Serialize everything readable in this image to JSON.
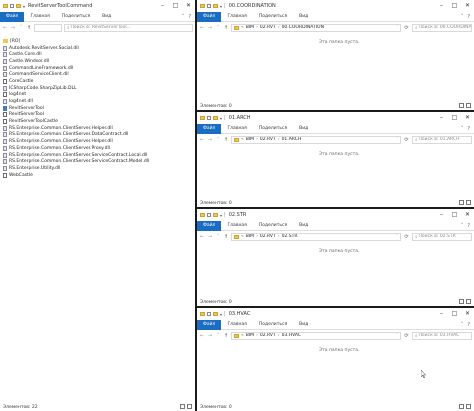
{
  "ribbon": {
    "file": "Файл",
    "home": "Главная",
    "share": "Поделиться",
    "view": "Вид"
  },
  "left": {
    "title": "RevitServerToolCommand",
    "search_placeholder": "Поиск в: RevitServerTool...",
    "files": [
      {
        "name": "[RO]",
        "type": "folder"
      },
      {
        "name": "Autodesk.RevitServer.Social.dll",
        "type": "dll"
      },
      {
        "name": "Castle.Core.dll",
        "type": "dll"
      },
      {
        "name": "Castle.Windsor.dll",
        "type": "dll"
      },
      {
        "name": "CommandLineFramework.dll",
        "type": "dll"
      },
      {
        "name": "CommandServiceClient.dll",
        "type": "dll"
      },
      {
        "name": "CoreCastle",
        "type": "config"
      },
      {
        "name": "ICSharpCode.SharpZipLib.DLL",
        "type": "dll"
      },
      {
        "name": "log4net",
        "type": "config"
      },
      {
        "name": "log4net.dll",
        "type": "dll"
      },
      {
        "name": "RevitServerTool",
        "type": "exe"
      },
      {
        "name": "RevitServerTool",
        "type": "config"
      },
      {
        "name": "RevitServerToolCastle",
        "type": "config"
      },
      {
        "name": "RS.Enterprise.Common.ClientServer.Helper.dll",
        "type": "dll"
      },
      {
        "name": "RS.Enterprise.Common.ClientServer.DataContract.dll",
        "type": "dll"
      },
      {
        "name": "RS.Enterprise.Common.ClientServer.Helper.dll",
        "type": "dll"
      },
      {
        "name": "RS.Enterprise.Common.ClientServer.Proxy.dll",
        "type": "dll"
      },
      {
        "name": "RS.Enterprise.Common.ClientServer.ServiceContract.Local.dll",
        "type": "dll"
      },
      {
        "name": "RS.Enterprise.Common.ClientServer.ServiceContract.Model.dll",
        "type": "dll"
      },
      {
        "name": "RS.Enterprise.Utility.dll",
        "type": "dll"
      },
      {
        "name": "WebCastle",
        "type": "config"
      }
    ],
    "status": "Элементов: 22"
  },
  "right": [
    {
      "title": "00.COORDINATION",
      "crumbs": [
        "BIM",
        "02.RVT",
        "00.COORDINATION"
      ],
      "search": "Поиск в: 00.COORDINATION",
      "empty": "Эта папка пуста.",
      "status": "Элементов: 0"
    },
    {
      "title": "01.ARCH",
      "crumbs": [
        "BIM",
        "02.RVT",
        "01.ARCH"
      ],
      "search": "Поиск в: 01.ARCH",
      "empty": "Эта папка пуста.",
      "status": "Элементов: 0"
    },
    {
      "title": "02.STR",
      "crumbs": [
        "BIM",
        "02.RVT",
        "02.STR"
      ],
      "search": "Поиск в: 02.STR",
      "empty": "Эта папка пуста.",
      "status": "Элементов: 0"
    },
    {
      "title": "03.HVAC",
      "crumbs": [
        "BIM",
        "02.RVT",
        "03.HVAC"
      ],
      "search": "Поиск в: 03.HVAC",
      "empty": "Эта папка пуста.",
      "status": "Элементов: 0"
    }
  ]
}
